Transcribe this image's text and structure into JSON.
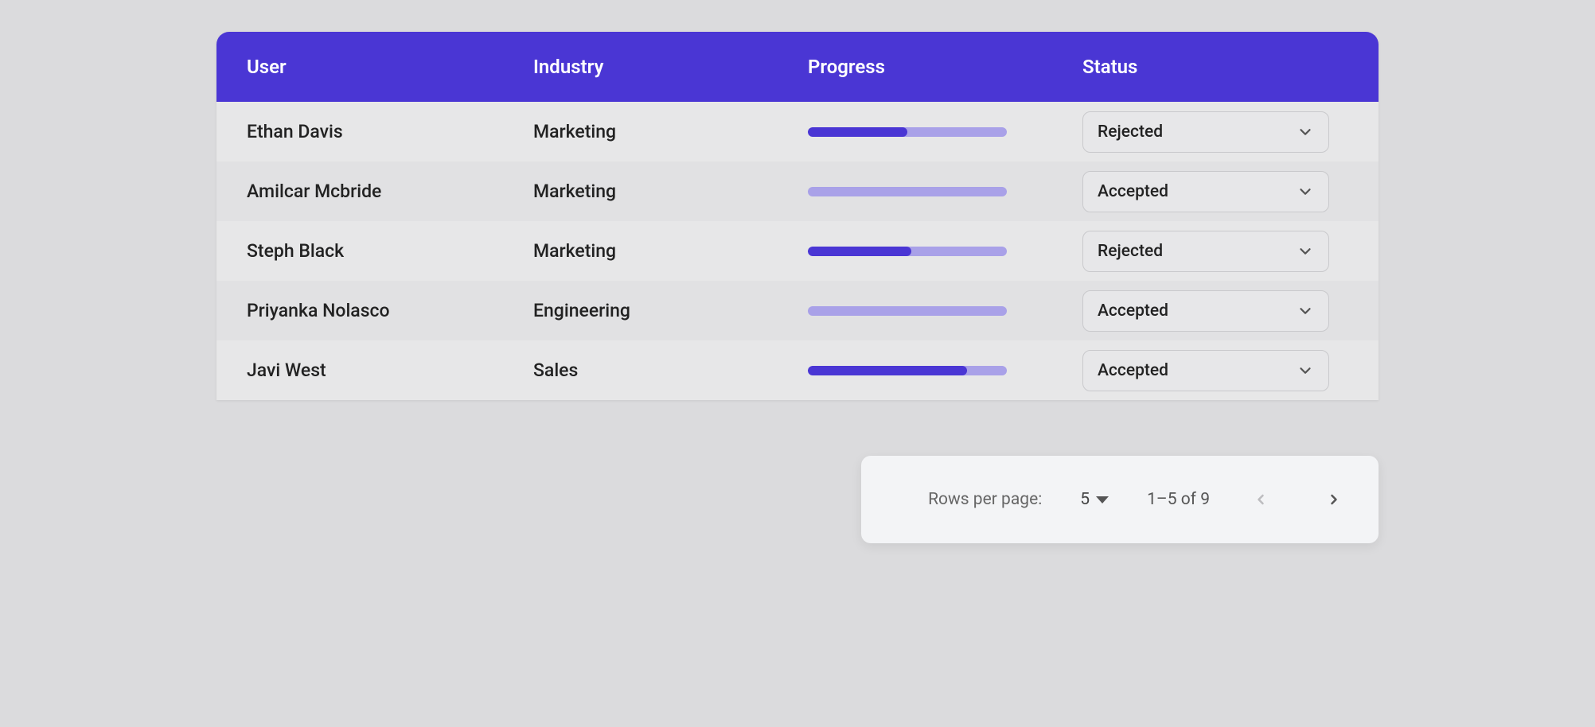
{
  "columns": {
    "user": "User",
    "industry": "Industry",
    "progress": "Progress",
    "status": "Status"
  },
  "rows": [
    {
      "user": "Ethan Davis",
      "industry": "Marketing",
      "progress": 50,
      "status": "Rejected"
    },
    {
      "user": "Amilcar Mcbride",
      "industry": "Marketing",
      "progress": 0,
      "status": "Accepted"
    },
    {
      "user": "Steph Black",
      "industry": "Marketing",
      "progress": 52,
      "status": "Rejected"
    },
    {
      "user": "Priyanka Nolasco",
      "industry": "Engineering",
      "progress": 0,
      "status": "Accepted"
    },
    {
      "user": "Javi West",
      "industry": "Sales",
      "progress": 80,
      "status": "Accepted"
    }
  ],
  "status_options": [
    "Accepted",
    "Rejected"
  ],
  "pagination": {
    "rows_per_page_label": "Rows per page:",
    "rows_per_page_value": "5",
    "range_text": "1–5 of 9",
    "prev_disabled": true,
    "next_disabled": false
  }
}
